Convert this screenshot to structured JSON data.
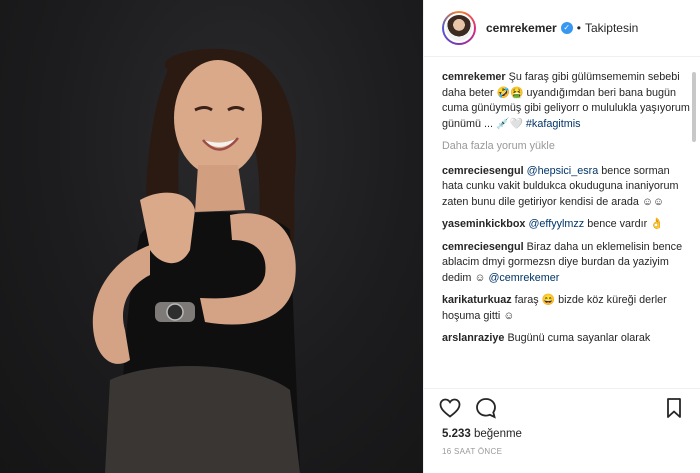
{
  "header": {
    "username": "cemrekemer",
    "separator": "•",
    "follow_state": "Takiptesin",
    "verified_glyph": "✓"
  },
  "caption": {
    "user": "cemrekemer",
    "text_1": "Şu faraş gibi gülümsememin sebebi daha beter",
    "emoji_1": "🤣🤮",
    "text_2": "uyandığımdan beri bana bugün cuma günüymüş gibi geliyorr o mululukla yaşıyorum günümü ...",
    "emoji_2": "💉🤍",
    "hashtag": "#kafagitmis"
  },
  "load_more": "Daha fazla yorum yükle",
  "comments": [
    {
      "user": "cemreciesengul",
      "mention": "@hepsici_esra",
      "text": "bence sorman hata cunku vakit buldukca okuduguna inaniyorum zaten bunu dile getiriyor kendisi de arada ☺☺"
    },
    {
      "user": "yaseminkickbox",
      "mention": "@effyylmzz",
      "text": "bence vardır 👌"
    },
    {
      "user": "cemreciesengul",
      "text": "Biraz daha un eklemelisin bence ablacim dmyi gormezsn diye burdan da yaziyim dedim ☺",
      "mention": "@cemrekemer"
    },
    {
      "user": "karikaturkuaz",
      "text": "faraş 😄 bizde köz küreği derler hoşuma gitti ☺"
    },
    {
      "user": "arslanraziye",
      "text": "Bugünü cuma sayanlar olarak"
    }
  ],
  "likes": {
    "count": "5.233",
    "label": "beğenme"
  },
  "timestamp": "16 SAAT ÖNCE",
  "icons": [
    "heart-icon",
    "comment-icon",
    "bookmark-icon"
  ],
  "colors": {
    "link": "#003569",
    "verified": "#3897f0",
    "muted": "#999999"
  }
}
